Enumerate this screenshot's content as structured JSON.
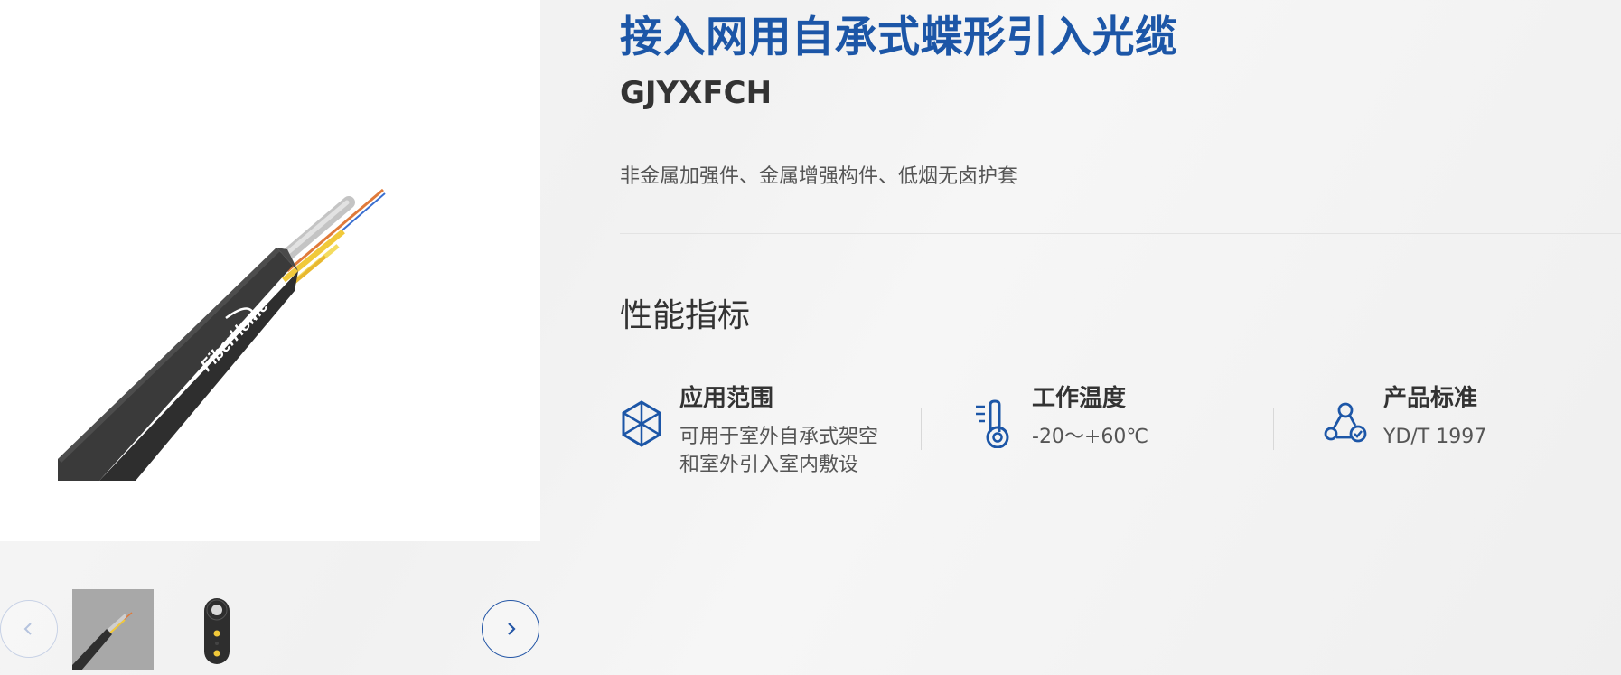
{
  "product": {
    "title": "接入网用自承式蝶形引入光缆",
    "model": "GJYXFCH",
    "features": "非金属加强件、金属增强构件、低烟无卤护套"
  },
  "gallery": {
    "main_image_brand": "FiberHome",
    "prev_icon": "chevron-left",
    "next_icon": "chevron-right",
    "thumbnails": [
      {
        "name": "cable-side-view",
        "selected": true
      },
      {
        "name": "cable-cross-section",
        "selected": false
      }
    ]
  },
  "performance": {
    "section_title": "性能指标",
    "specs": [
      {
        "icon": "cube-icon",
        "label": "应用范围",
        "value": "可用于室外自承式架空和室外引入室内敷设"
      },
      {
        "icon": "thermometer-icon",
        "label": "工作温度",
        "value": "-20～+60℃"
      },
      {
        "icon": "network-check-icon",
        "label": "产品标准",
        "value": "YD/T 1997"
      }
    ]
  },
  "colors": {
    "accent": "#1c56a7",
    "text": "#333333",
    "muted": "#555555"
  }
}
